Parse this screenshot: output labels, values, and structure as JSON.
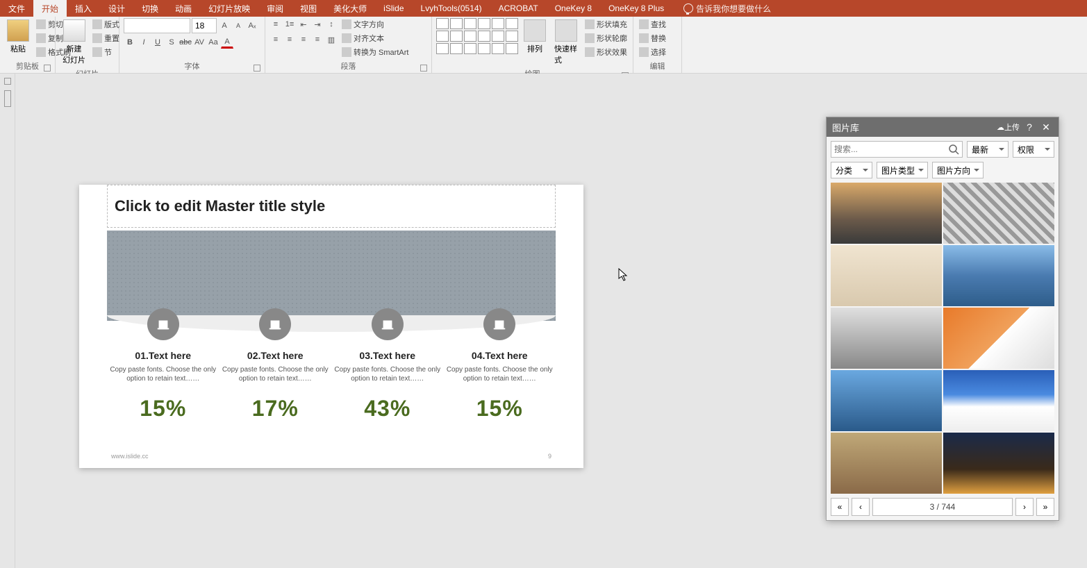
{
  "tabs": {
    "file": "文件",
    "home": "开始",
    "insert": "插入",
    "design": "设计",
    "transition": "切换",
    "animation": "动画",
    "slideshow": "幻灯片放映",
    "review": "审阅",
    "view": "视图",
    "beautify": "美化大师",
    "islide": "iSlide",
    "lvyh": "LvyhTools(0514)",
    "acrobat": "ACROBAT",
    "onekey8": "OneKey 8",
    "onekey8plus": "OneKey 8 Plus",
    "tell": "告诉我你想要做什么"
  },
  "ribbon": {
    "clipboard": {
      "label": "剪贴板",
      "paste": "粘贴",
      "cut": "剪切",
      "copy": "复制",
      "painter": "格式刷"
    },
    "slides": {
      "label": "幻灯片",
      "new": "新建\n幻灯片",
      "layout": "版式",
      "reset": "重置",
      "section": "节"
    },
    "font": {
      "label": "字体",
      "size": "18"
    },
    "paragraph": {
      "label": "段落",
      "direction": "文字方向",
      "align": "对齐文本",
      "smartart": "转换为 SmartArt"
    },
    "drawing": {
      "label": "绘图",
      "arrange": "排列",
      "quickstyle": "快速样式",
      "fill": "形状填充",
      "outline": "形状轮廓",
      "effect": "形状效果"
    },
    "editing": {
      "label": "编辑",
      "find": "查找",
      "replace": "替换",
      "select": "选择"
    }
  },
  "slide": {
    "title": "Click to edit Master title style",
    "items": [
      {
        "h": "01.Text here",
        "p": "Copy paste fonts. Choose the only option to retain text……",
        "pct": "15%"
      },
      {
        "h": "02.Text here",
        "p": "Copy paste fonts. Choose the only option to retain text……",
        "pct": "17%"
      },
      {
        "h": "03.Text here",
        "p": "Copy paste fonts. Choose the only option to retain text……",
        "pct": "43%"
      },
      {
        "h": "04.Text here",
        "p": "Copy paste fonts. Choose the only option to retain text……",
        "pct": "15%"
      }
    ],
    "footer": "www.islide.cc",
    "pagenum": "9"
  },
  "panel": {
    "title": "图片库",
    "upload": "上传",
    "search_ph": "搜索...",
    "sort": "最新",
    "perm": "权限",
    "cat": "分类",
    "type": "图片类型",
    "orient": "图片方向",
    "page": "3 / 744"
  }
}
